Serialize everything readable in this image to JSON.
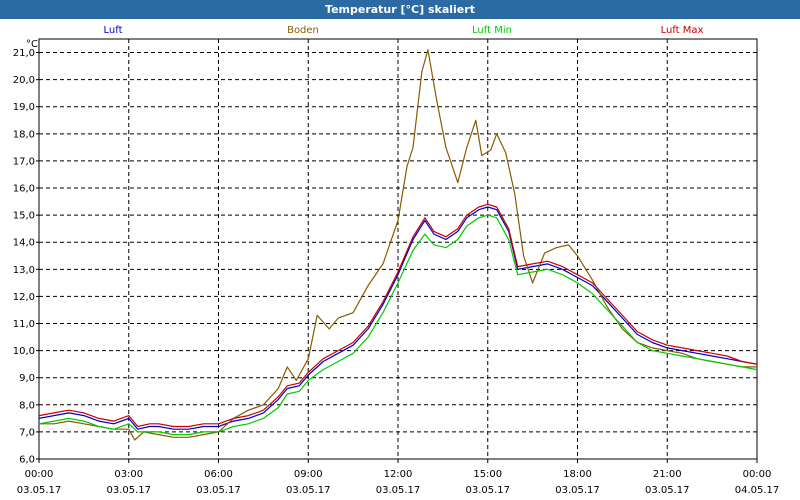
{
  "title": "Temperatur [°C] skaliert",
  "chart_data": {
    "type": "line",
    "ylabel": "°C",
    "ylim": [
      6.0,
      21.5
    ],
    "yticks": [
      6.0,
      7.0,
      8.0,
      9.0,
      10.0,
      11.0,
      12.0,
      13.0,
      14.0,
      15.0,
      16.0,
      17.0,
      18.0,
      19.0,
      20.0,
      21.0
    ],
    "ytick_labels": [
      "6,0",
      "7,0",
      "8,0",
      "9,0",
      "10,0",
      "11,0",
      "12,0",
      "13,0",
      "14,0",
      "15,0",
      "16,0",
      "17,0",
      "18,0",
      "19,0",
      "20,0",
      "21,0"
    ],
    "xlim": [
      0,
      24
    ],
    "xticks": [
      {
        "x": 0,
        "time": "00:00",
        "date": "03.05.17"
      },
      {
        "x": 3,
        "time": "03:00",
        "date": "03.05.17"
      },
      {
        "x": 6,
        "time": "06:00",
        "date": "03.05.17"
      },
      {
        "x": 9,
        "time": "09:00",
        "date": "03.05.17"
      },
      {
        "x": 12,
        "time": "12:00",
        "date": "03.05.17"
      },
      {
        "x": 15,
        "time": "15:00",
        "date": "03.05.17"
      },
      {
        "x": 18,
        "time": "18:00",
        "date": "03.05.17"
      },
      {
        "x": 21,
        "time": "21:00",
        "date": "03.05.17"
      },
      {
        "x": 24,
        "time": "00:00",
        "date": "04.05.17"
      }
    ],
    "grid": true,
    "legend_position": "top",
    "series": [
      {
        "name": "Luft",
        "color": "#0000cc",
        "points": [
          [
            0,
            7.5
          ],
          [
            0.5,
            7.6
          ],
          [
            1,
            7.7
          ],
          [
            1.5,
            7.6
          ],
          [
            2,
            7.4
          ],
          [
            2.5,
            7.3
          ],
          [
            3,
            7.5
          ],
          [
            3.3,
            7.1
          ],
          [
            3.7,
            7.2
          ],
          [
            4,
            7.2
          ],
          [
            4.5,
            7.1
          ],
          [
            5,
            7.1
          ],
          [
            5.5,
            7.2
          ],
          [
            6,
            7.2
          ],
          [
            6.5,
            7.4
          ],
          [
            7,
            7.5
          ],
          [
            7.5,
            7.7
          ],
          [
            8,
            8.2
          ],
          [
            8.3,
            8.6
          ],
          [
            8.7,
            8.7
          ],
          [
            9,
            9.1
          ],
          [
            9.5,
            9.6
          ],
          [
            10,
            9.9
          ],
          [
            10.5,
            10.2
          ],
          [
            11,
            10.8
          ],
          [
            11.5,
            11.7
          ],
          [
            12,
            12.8
          ],
          [
            12.5,
            14.1
          ],
          [
            12.9,
            14.8
          ],
          [
            13.2,
            14.3
          ],
          [
            13.6,
            14.1
          ],
          [
            14,
            14.4
          ],
          [
            14.3,
            14.9
          ],
          [
            14.7,
            15.2
          ],
          [
            15,
            15.3
          ],
          [
            15.3,
            15.2
          ],
          [
            15.7,
            14.4
          ],
          [
            16,
            13.0
          ],
          [
            16.5,
            13.1
          ],
          [
            17,
            13.2
          ],
          [
            17.5,
            13.0
          ],
          [
            18,
            12.7
          ],
          [
            18.5,
            12.4
          ],
          [
            19,
            11.8
          ],
          [
            19.5,
            11.2
          ],
          [
            20,
            10.6
          ],
          [
            20.5,
            10.3
          ],
          [
            21,
            10.1
          ],
          [
            21.5,
            10.0
          ],
          [
            22,
            9.9
          ],
          [
            22.5,
            9.8
          ],
          [
            23,
            9.7
          ],
          [
            23.5,
            9.6
          ],
          [
            24,
            9.5
          ]
        ]
      },
      {
        "name": "Boden",
        "color": "#8b5a00",
        "points": [
          [
            0,
            7.3
          ],
          [
            0.5,
            7.3
          ],
          [
            1,
            7.4
          ],
          [
            1.5,
            7.3
          ],
          [
            2,
            7.2
          ],
          [
            2.5,
            7.1
          ],
          [
            3,
            7.1
          ],
          [
            3.2,
            6.7
          ],
          [
            3.5,
            7.0
          ],
          [
            4,
            6.9
          ],
          [
            4.5,
            6.8
          ],
          [
            5,
            6.8
          ],
          [
            5.5,
            6.9
          ],
          [
            6,
            7.0
          ],
          [
            6.5,
            7.5
          ],
          [
            7,
            7.8
          ],
          [
            7.5,
            8.0
          ],
          [
            8,
            8.6
          ],
          [
            8.3,
            9.4
          ],
          [
            8.6,
            8.9
          ],
          [
            9,
            9.7
          ],
          [
            9.3,
            11.3
          ],
          [
            9.7,
            10.8
          ],
          [
            10,
            11.2
          ],
          [
            10.5,
            11.4
          ],
          [
            11,
            12.4
          ],
          [
            11.5,
            13.2
          ],
          [
            12,
            14.8
          ],
          [
            12.3,
            16.8
          ],
          [
            12.5,
            17.5
          ],
          [
            12.8,
            20.3
          ],
          [
            13.0,
            21.1
          ],
          [
            13.3,
            19.2
          ],
          [
            13.6,
            17.5
          ],
          [
            14.0,
            16.2
          ],
          [
            14.3,
            17.5
          ],
          [
            14.6,
            18.5
          ],
          [
            14.8,
            17.2
          ],
          [
            15.1,
            17.4
          ],
          [
            15.3,
            18.0
          ],
          [
            15.6,
            17.3
          ],
          [
            15.9,
            15.8
          ],
          [
            16.2,
            13.5
          ],
          [
            16.5,
            12.5
          ],
          [
            16.9,
            13.6
          ],
          [
            17.3,
            13.8
          ],
          [
            17.7,
            13.9
          ],
          [
            18,
            13.5
          ],
          [
            18.5,
            12.6
          ],
          [
            19,
            11.6
          ],
          [
            19.5,
            10.8
          ],
          [
            20,
            10.3
          ],
          [
            20.5,
            10.1
          ],
          [
            21,
            10.0
          ],
          [
            21.5,
            9.9
          ],
          [
            22,
            9.7
          ],
          [
            22.5,
            9.6
          ],
          [
            23,
            9.5
          ],
          [
            23.5,
            9.4
          ],
          [
            24,
            9.4
          ]
        ]
      },
      {
        "name": "Luft Min",
        "color": "#00cc00",
        "points": [
          [
            0,
            7.3
          ],
          [
            0.5,
            7.4
          ],
          [
            1,
            7.5
          ],
          [
            1.5,
            7.4
          ],
          [
            2,
            7.2
          ],
          [
            2.5,
            7.1
          ],
          [
            3,
            7.3
          ],
          [
            3.3,
            7.0
          ],
          [
            3.7,
            7.0
          ],
          [
            4,
            7.0
          ],
          [
            4.5,
            6.9
          ],
          [
            5,
            6.9
          ],
          [
            5.5,
            7.0
          ],
          [
            6,
            7.0
          ],
          [
            6.5,
            7.2
          ],
          [
            7,
            7.3
          ],
          [
            7.5,
            7.5
          ],
          [
            8,
            7.9
          ],
          [
            8.3,
            8.4
          ],
          [
            8.7,
            8.5
          ],
          [
            9,
            8.9
          ],
          [
            9.5,
            9.3
          ],
          [
            10,
            9.6
          ],
          [
            10.5,
            9.9
          ],
          [
            11,
            10.5
          ],
          [
            11.5,
            11.4
          ],
          [
            12,
            12.5
          ],
          [
            12.5,
            13.7
          ],
          [
            12.9,
            14.3
          ],
          [
            13.2,
            13.9
          ],
          [
            13.6,
            13.8
          ],
          [
            14,
            14.1
          ],
          [
            14.3,
            14.6
          ],
          [
            14.7,
            14.9
          ],
          [
            15,
            15.0
          ],
          [
            15.3,
            14.9
          ],
          [
            15.7,
            14.1
          ],
          [
            16,
            12.8
          ],
          [
            16.5,
            12.9
          ],
          [
            17,
            13.0
          ],
          [
            17.5,
            12.8
          ],
          [
            18,
            12.5
          ],
          [
            18.5,
            12.1
          ],
          [
            19,
            11.5
          ],
          [
            19.5,
            10.9
          ],
          [
            20,
            10.3
          ],
          [
            20.5,
            10.0
          ],
          [
            21,
            9.9
          ],
          [
            21.5,
            9.8
          ],
          [
            22,
            9.7
          ],
          [
            22.5,
            9.6
          ],
          [
            23,
            9.5
          ],
          [
            23.5,
            9.4
          ],
          [
            24,
            9.3
          ]
        ]
      },
      {
        "name": "Luft Max",
        "color": "#cc0000",
        "points": [
          [
            0,
            7.6
          ],
          [
            0.5,
            7.7
          ],
          [
            1,
            7.8
          ],
          [
            1.5,
            7.7
          ],
          [
            2,
            7.5
          ],
          [
            2.5,
            7.4
          ],
          [
            3,
            7.6
          ],
          [
            3.3,
            7.2
          ],
          [
            3.7,
            7.3
          ],
          [
            4,
            7.3
          ],
          [
            4.5,
            7.2
          ],
          [
            5,
            7.2
          ],
          [
            5.5,
            7.3
          ],
          [
            6,
            7.3
          ],
          [
            6.5,
            7.5
          ],
          [
            7,
            7.6
          ],
          [
            7.5,
            7.8
          ],
          [
            8,
            8.3
          ],
          [
            8.3,
            8.7
          ],
          [
            8.7,
            8.8
          ],
          [
            9,
            9.2
          ],
          [
            9.5,
            9.7
          ],
          [
            10,
            10.0
          ],
          [
            10.5,
            10.3
          ],
          [
            11,
            10.9
          ],
          [
            11.5,
            11.8
          ],
          [
            12,
            12.9
          ],
          [
            12.5,
            14.2
          ],
          [
            12.9,
            14.9
          ],
          [
            13.2,
            14.4
          ],
          [
            13.6,
            14.2
          ],
          [
            14,
            14.5
          ],
          [
            14.3,
            15.0
          ],
          [
            14.7,
            15.3
          ],
          [
            15,
            15.4
          ],
          [
            15.3,
            15.3
          ],
          [
            15.7,
            14.5
          ],
          [
            16,
            13.1
          ],
          [
            16.5,
            13.2
          ],
          [
            17,
            13.3
          ],
          [
            17.5,
            13.1
          ],
          [
            18,
            12.8
          ],
          [
            18.5,
            12.5
          ],
          [
            19,
            11.9
          ],
          [
            19.5,
            11.3
          ],
          [
            20,
            10.7
          ],
          [
            20.5,
            10.4
          ],
          [
            21,
            10.2
          ],
          [
            21.5,
            10.1
          ],
          [
            22,
            10.0
          ],
          [
            22.5,
            9.9
          ],
          [
            23,
            9.8
          ],
          [
            23.5,
            9.6
          ],
          [
            24,
            9.5
          ]
        ]
      }
    ]
  }
}
